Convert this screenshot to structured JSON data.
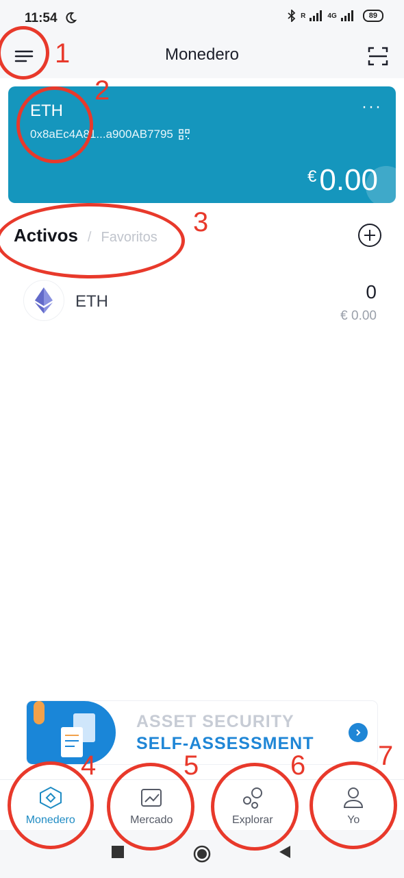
{
  "status_bar": {
    "time": "11:54",
    "battery": "89",
    "net_r": "R",
    "net_4g": "4G"
  },
  "app_bar": {
    "title": "Monedero",
    "menu_icon": "hamburger-icon",
    "scan_icon": "scan-icon"
  },
  "wallet_card": {
    "token": "ETH",
    "address": "0x8aEc4A81...a900AB7795",
    "currency": "€",
    "balance": "0.00",
    "more": "···",
    "color": "#1596bd"
  },
  "tabs": {
    "active": "Activos",
    "separator": "/",
    "inactive": "Favoritos"
  },
  "assets": [
    {
      "name": "ETH",
      "amount": "0",
      "fiat": "€ 0.00"
    }
  ],
  "banner": {
    "line1": "ASSET SECURITY",
    "line2": "SELF-ASSESSMENT"
  },
  "bottom_nav": [
    {
      "label": "Monedero",
      "icon": "wallet-icon",
      "active": true
    },
    {
      "label": "Mercado",
      "icon": "chart-icon",
      "active": false
    },
    {
      "label": "Explorar",
      "icon": "explore-icon",
      "active": false
    },
    {
      "label": "Yo",
      "icon": "user-icon",
      "active": false
    }
  ],
  "annotations": [
    "1",
    "2",
    "3",
    "4",
    "5",
    "6",
    "7"
  ]
}
